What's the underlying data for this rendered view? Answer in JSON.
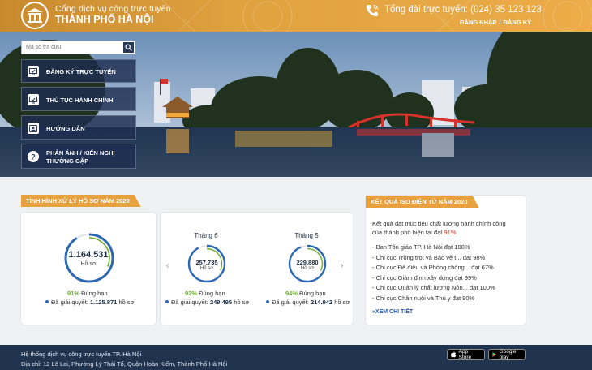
{
  "header": {
    "title_line1": "Cổng dịch vụ công trực tuyến",
    "title_line2": "THÀNH PHỐ HÀ NỘI",
    "hotline": "Tổng đài trực tuyến: (024) 35 123 123",
    "login": "ĐĂNG NHẬP",
    "separator": "/",
    "register": "ĐĂNG KÝ"
  },
  "search": {
    "placeholder": "Mã số tra cứu"
  },
  "menu": [
    {
      "label": "ĐĂNG KÝ TRỰC TUYẾN",
      "icon": "monitor-icon"
    },
    {
      "label": "THỦ TỤC HÀNH CHÍNH",
      "icon": "monitor-icon"
    },
    {
      "label": "HƯỚNG DẪN",
      "icon": "id-card-icon"
    },
    {
      "label_line1": "PHẢN ÁNH / KIẾN NGHỊ",
      "label_line2": "THƯỜNG GẶP",
      "icon": "question-icon"
    }
  ],
  "stats": {
    "section_title": "TÌNH HÌNH XỬ LÝ HỒ SƠ NĂM 2020",
    "total": {
      "count": "1.164.531",
      "unit": "Hồ sơ",
      "pct": "91%",
      "pct_label": "Đúng hạn",
      "solved_label": "Đã giải quyết:",
      "solved": "1.125.871",
      "solved_unit": "hồ sơ"
    },
    "months": [
      {
        "month": "Tháng 6",
        "count": "257.735",
        "unit": "Hồ sơ",
        "pct": "92%",
        "pct_label": "Đúng hạn",
        "solved_label": "Đã giải quyết:",
        "solved": "249.495",
        "solved_unit": "hồ sơ"
      },
      {
        "month": "Tháng 5",
        "count": "229.880",
        "unit": "Hồ sơ",
        "pct": "94%",
        "pct_label": "Đúng hạn",
        "solved_label": "Đã giải quyết:",
        "solved": "214.942",
        "solved_unit": "hồ sơ"
      }
    ],
    "prev_symbol": "‹",
    "next_symbol": "›"
  },
  "iso": {
    "section_title": "KẾT QUẢ ISO ĐIỆN TỬ NĂM 2020",
    "intro_line1": "Kết quả đạt mục tiêu chất lượng hành chính công",
    "intro_line2": "của thành phố hiện tại đạt",
    "intro_pct": "91%",
    "items": [
      "- Ban Tôn giáo TP. Hà Nội đạt 100%",
      "- Chi cục Trồng trọt và Bảo vệ t... đạt 98%",
      "- Chi cục Đê điều và Phòng chống... đạt 67%",
      "- Chi cục Giám định xây dựng đạt 99%",
      "- Chi cục Quản lý chất lượng Nôn... đạt 100%",
      "- Chi cục Chăn nuôi và Thú y đạt 90%"
    ],
    "more": "XEM CHI TIẾT"
  },
  "footer": {
    "line1": "Hệ thống dịch vụ công trực tuyến TP. Hà Nội",
    "line2": "Địa chỉ: 12 Lê Lai, Phường Lý Thái Tổ, Quận Hoàn Kiếm, Thành Phố Hà Nội",
    "appstore": "App Store",
    "googleplay": "Google play"
  },
  "colors": {
    "header_orange": "#e0a13f",
    "nav_dark": "#203450",
    "ring_blue": "#2d68b3",
    "ring_green": "#6cae2c",
    "ring_track": "#dfe3e8",
    "accent_red": "#d0331f"
  }
}
